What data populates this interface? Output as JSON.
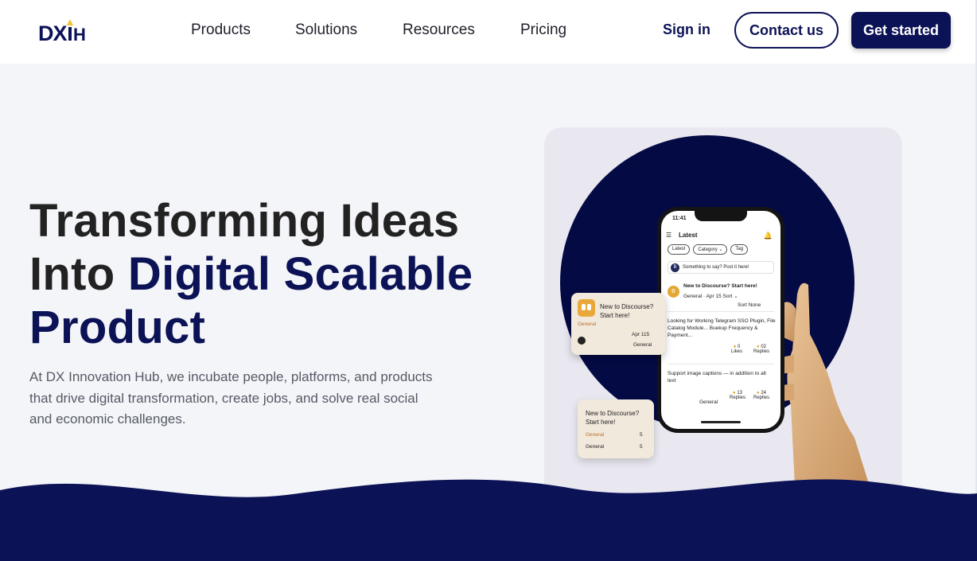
{
  "brand": {
    "logo_text": "DXIH",
    "primary_color": "#0c1256",
    "accent_color": "#f2c230"
  },
  "nav": {
    "items": [
      "Products",
      "Solutions",
      "Resources",
      "Pricing"
    ],
    "sign_in": "Sign in",
    "contact": "Contact us",
    "get_started": "Get started"
  },
  "hero": {
    "title_line1": "Transforming Ideas",
    "title_line2_plain": "Into ",
    "title_line2_accent": "Digital Scalable",
    "title_line3": "Product",
    "description": "At DX Innovation Hub, we incubate people, platforms, and products that drive digital transformation, create jobs, and solve real social and economic challenges."
  },
  "phone": {
    "time": "11:41",
    "header": "Latest",
    "chips": [
      "Latest",
      "Category ⌄",
      "Tag"
    ],
    "post_prompt": "Something to say? Post it here!",
    "topics": [
      {
        "title": "New to Discourse? Start here!",
        "meta": "General  ·  Apr 15  Sort ⌄",
        "sub": "Sort    None"
      },
      {
        "title": "Looking for Working Telegram SSO Plugin, File Catalog Module... Buekup Frequency & Payment...",
        "likes": "0",
        "likes_label": "Likes",
        "replies": "02",
        "replies_label": "Replies"
      },
      {
        "title": "Support image captions — in addition to alt text",
        "category": "General",
        "likes": "13",
        "likes_label": "Replies",
        "replies": "24",
        "replies_label": "Replies"
      }
    ]
  },
  "float_card_1": {
    "title": "New to Discourse? Start here!",
    "category": "General",
    "date": "Apr 115",
    "footer": "General"
  },
  "float_card_2": {
    "title": "New to Discourse? Start here!",
    "rows": [
      {
        "label": "General",
        "value": "5"
      },
      {
        "label": "General",
        "value": "5"
      }
    ]
  }
}
